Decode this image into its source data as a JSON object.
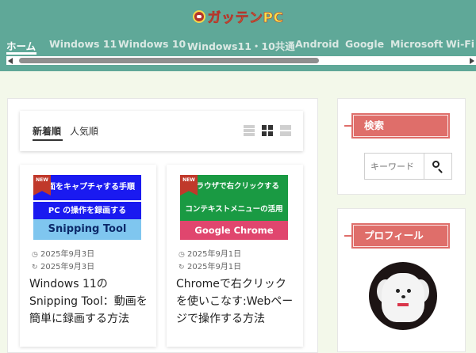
{
  "site": {
    "logo_text": "ガッテンPC"
  },
  "nav": {
    "items": [
      "ホーム",
      "Windows 11",
      "Windows 10",
      "Windows11・10共通",
      "Android",
      "Google",
      "Microsoft",
      "Wi-Fi"
    ],
    "active_index": 0
  },
  "tabs": {
    "newest": "新着順",
    "popular": "人気順",
    "view_icons": [
      "list-view-icon",
      "grid-view-icon",
      "rows-view-icon"
    ],
    "active_view": "grid"
  },
  "posts": [
    {
      "badge": "NEW",
      "thumb_lines": [
        "画面をキャプチャする手順",
        "PC の操作を録画する",
        "Snipping Tool"
      ],
      "published": "2025年9月3日",
      "updated": "2025年9月3日",
      "title": "Windows 11の Snipping Tool：動画を簡単に録画する方法"
    },
    {
      "badge": "NEW",
      "thumb_lines": [
        "ブラウザで右クリックする",
        "コンテキストメニューの活用",
        "Google Chrome"
      ],
      "published": "2025年9月1日",
      "updated": "2025年9月1日",
      "title": "Chromeで右クリックを使いこなす:Webページで操作する方法"
    }
  ],
  "sidebar": {
    "search_heading": "検索",
    "search_placeholder": "キーワード",
    "profile_heading": "プロフィール"
  },
  "colors": {
    "header": "#5fa898",
    "accent": "#df6e6a",
    "background": "#f3f8ea"
  }
}
